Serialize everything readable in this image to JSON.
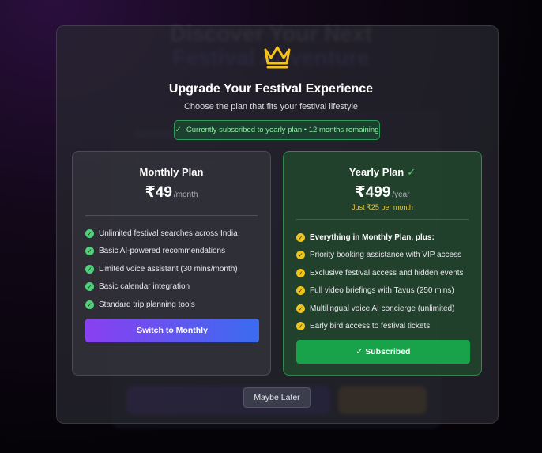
{
  "background": {
    "title_line1": "Discover Your Next",
    "title_line2": "Festival Adventure"
  },
  "modal": {
    "title": "Upgrade Your Festival Experience",
    "subtitle": "Choose the plan that fits your festival lifestyle",
    "status": "Currently subscribed to yearly plan • 12 months remaining",
    "status_icon": "check-icon"
  },
  "plans": {
    "monthly": {
      "name": "Monthly Plan",
      "price": "₹49",
      "period": "/month",
      "features": [
        "Unlimited festival searches across India",
        "Basic AI-powered recommendations",
        "Limited voice assistant (30 mins/month)",
        "Basic calendar integration",
        "Standard trip planning tools"
      ],
      "button": "Switch to Monthly"
    },
    "yearly": {
      "name": "Yearly Plan",
      "current_icon": "✓",
      "price": "₹499",
      "period": "/year",
      "note": "Just ₹25 per month",
      "features": [
        "Everything in Monthly Plan, plus:",
        "Priority booking assistance with VIP access",
        "Exclusive festival access and hidden events",
        "Full video briefings with Tavus (250 mins)",
        "Multilingual voice AI concierge (unlimited)",
        "Early bird access to festival tickets"
      ],
      "button": "✓ Subscribed"
    }
  },
  "actions": {
    "later": "Maybe Later"
  },
  "colors": {
    "accent_green": "#18a34a",
    "gold": "#f0c418",
    "purple": "#8a3ff0",
    "blue": "#3a6cf0"
  }
}
